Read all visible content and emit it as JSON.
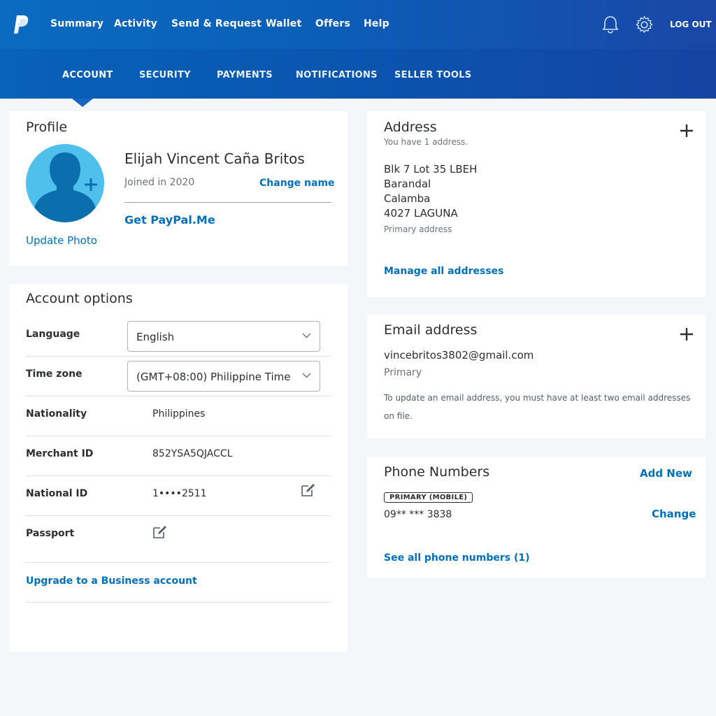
{
  "header": {
    "logo_icon": "paypal-logo-icon",
    "nav": [
      "Summary",
      "Activity",
      "Send & Request",
      "Wallet",
      "Offers",
      "Help"
    ],
    "notifications_icon": "bell-icon",
    "settings_icon": "gear-icon",
    "logout_label": "LOG OUT",
    "subnav": [
      "ACCOUNT",
      "SECURITY",
      "PAYMENTS",
      "NOTIFICATIONS",
      "SELLER TOOLS"
    ],
    "active_subnav": "ACCOUNT"
  },
  "profile": {
    "title": "Profile",
    "name": "Elijah Vincent Caña Britos",
    "joined": "Joined in 2020",
    "change_name": "Change name",
    "paypal_me": "Get PayPal.Me",
    "update_photo": "Update Photo"
  },
  "account_options": {
    "title": "Account options",
    "language_label": "Language",
    "language_value": "English",
    "timezone_label": "Time zone",
    "timezone_value": "(GMT+08:00) Philippine Time",
    "nationality_label": "Nationality",
    "nationality_value": "Philippines",
    "merchant_label": "Merchant ID",
    "merchant_value": "852YSA5QJACCL",
    "national_id_label": "National ID",
    "national_id_value": "1••••2511",
    "passport_label": "Passport",
    "upgrade_link": "Upgrade to a Business account"
  },
  "address": {
    "title": "Address",
    "count_text": "You have 1 address.",
    "lines": [
      "Blk 7 Lot 35 LBEH",
      "Barandal",
      "Calamba",
      "4027 LAGUNA"
    ],
    "primary_label": "Primary address",
    "manage_link": "Manage all addresses"
  },
  "email": {
    "title": "Email address",
    "address": "vincebritos3802@gmail.com",
    "primary": "Primary",
    "note_line1": "To update an email address, you must have at least two email addresses",
    "note_line2": "on file."
  },
  "phone": {
    "title": "Phone Numbers",
    "add_new": "Add New",
    "badge": "PRIMARY (MOBILE)",
    "number": "09** *** 3838",
    "change": "Change",
    "see_all": "See all phone numbers (1)"
  },
  "colors": {
    "brand_blue": "#0070ba",
    "header_start": "#0a6bc0",
    "header_end": "#1a47a8",
    "background": "#f5f6f9"
  }
}
